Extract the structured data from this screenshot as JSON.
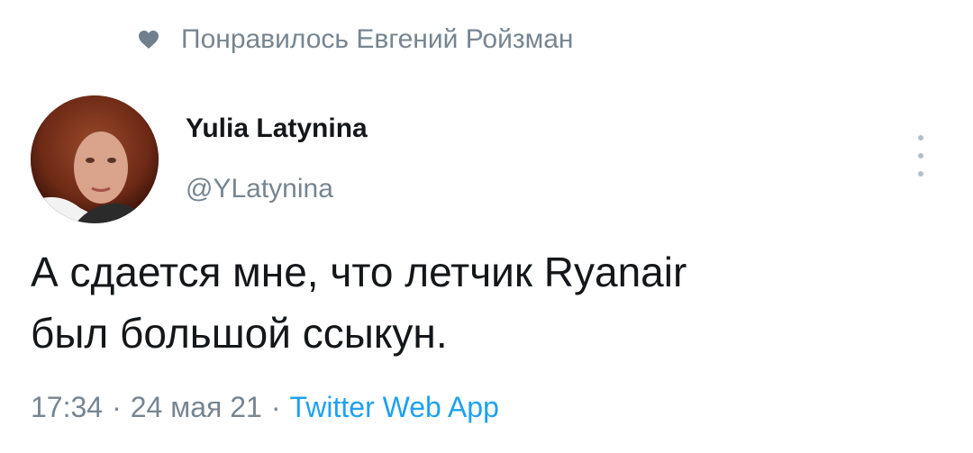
{
  "social_context": {
    "icon": "heart-icon",
    "text": "Понравилось Евгений Ройзман"
  },
  "author": {
    "name": "Yulia Latynina",
    "handle": "@YLatynina",
    "avatar": "avatar-photo"
  },
  "tweet": {
    "lines": [
      "А сдается мне, что летчик Ryanair",
      "был большой ссыкун."
    ]
  },
  "meta": {
    "time": "17:34",
    "date": "24 мая 21",
    "separator": "·",
    "source": "Twitter Web App"
  },
  "menu": {
    "icon": "more-vertical-icon"
  },
  "colors": {
    "text_primary": "#14171a",
    "text_secondary": "#768591",
    "link": "#1da1f2"
  }
}
